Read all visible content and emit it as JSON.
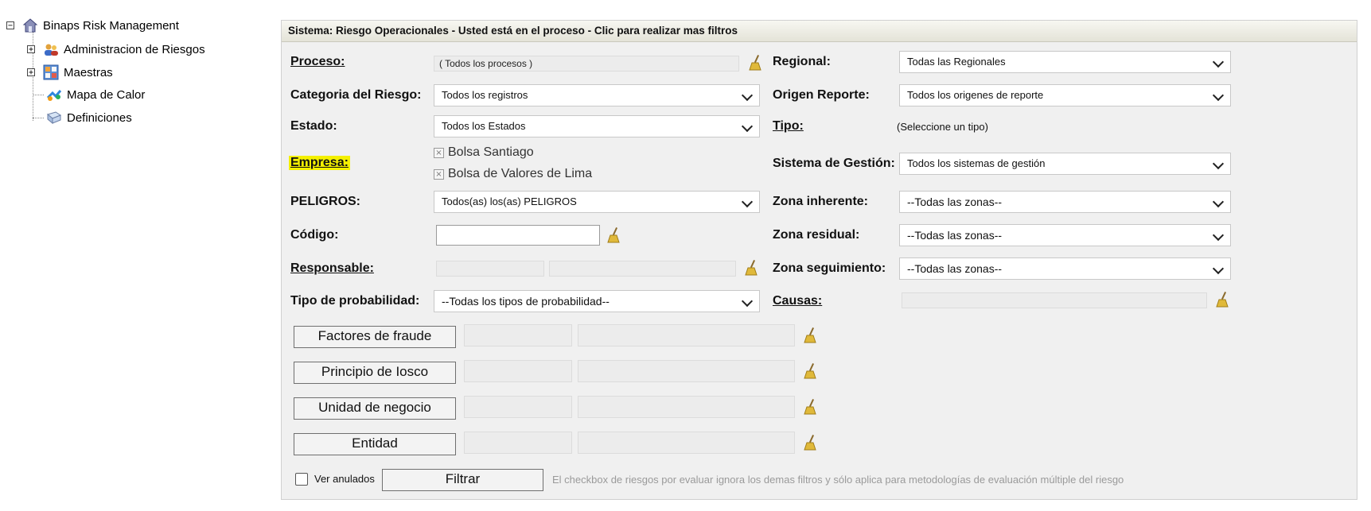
{
  "tree": {
    "root": "Binaps Risk Management",
    "items": [
      {
        "label": "Administracion de Riesgos",
        "expander": "+"
      },
      {
        "label": "Maestras",
        "expander": "+"
      },
      {
        "label": "Mapa de Calor"
      },
      {
        "label": "Definiciones"
      }
    ],
    "root_expander": "−"
  },
  "panel": {
    "header": "Sistema: Riesgo Operacionales - Usted está en el proceso - Clic para realizar mas filtros",
    "left": {
      "proceso_label": "Proceso:",
      "proceso_value": "( Todos los procesos )",
      "categoria_label": "Categoria del Riesgo:",
      "categoria_value": "Todos los registros",
      "estado_label": "Estado:",
      "estado_value": "Todos los Estados",
      "empresa_label": "Empresa:",
      "empresa_tags": [
        "Bolsa Santiago",
        "Bolsa de Valores de Lima"
      ],
      "peligros_label": "PELIGROS:",
      "peligros_value": "Todos(as) los(as) PELIGROS",
      "codigo_label": "Código:",
      "codigo_value": "",
      "responsable_label": "Responsable:",
      "tipo_prob_label": "Tipo de probabilidad:",
      "tipo_prob_value": "--Todas los tipos de probabilidad--"
    },
    "right": {
      "regional_label": "Regional:",
      "regional_value": "Todas las Regionales",
      "origen_label": "Origen Reporte:",
      "origen_value": "Todos los origenes de reporte",
      "tipo_label": "Tipo:",
      "tipo_value": "(Seleccione un tipo)",
      "sistema_label": "Sistema de Gestión:",
      "sistema_value": "Todos los sistemas de gestión",
      "zona_inh_label": "Zona inherente:",
      "zona_inh_value": "--Todas las zonas--",
      "zona_res_label": "Zona residual:",
      "zona_res_value": "--Todas las zonas--",
      "zona_seg_label": "Zona seguimiento:",
      "zona_seg_value": "--Todas las zonas--",
      "causas_label": "Causas:"
    },
    "buttons": [
      "Factores de fraude",
      "Principio de Iosco",
      "Unidad de negocio",
      "Entidad"
    ],
    "ver_anulados_label": "Ver anulados",
    "filtrar_label": "Filtrar",
    "note": "El checkbox de riesgos por evaluar ignora los demas filtros y sólo aplica para metodologías de evaluación múltiple del riesgo"
  }
}
